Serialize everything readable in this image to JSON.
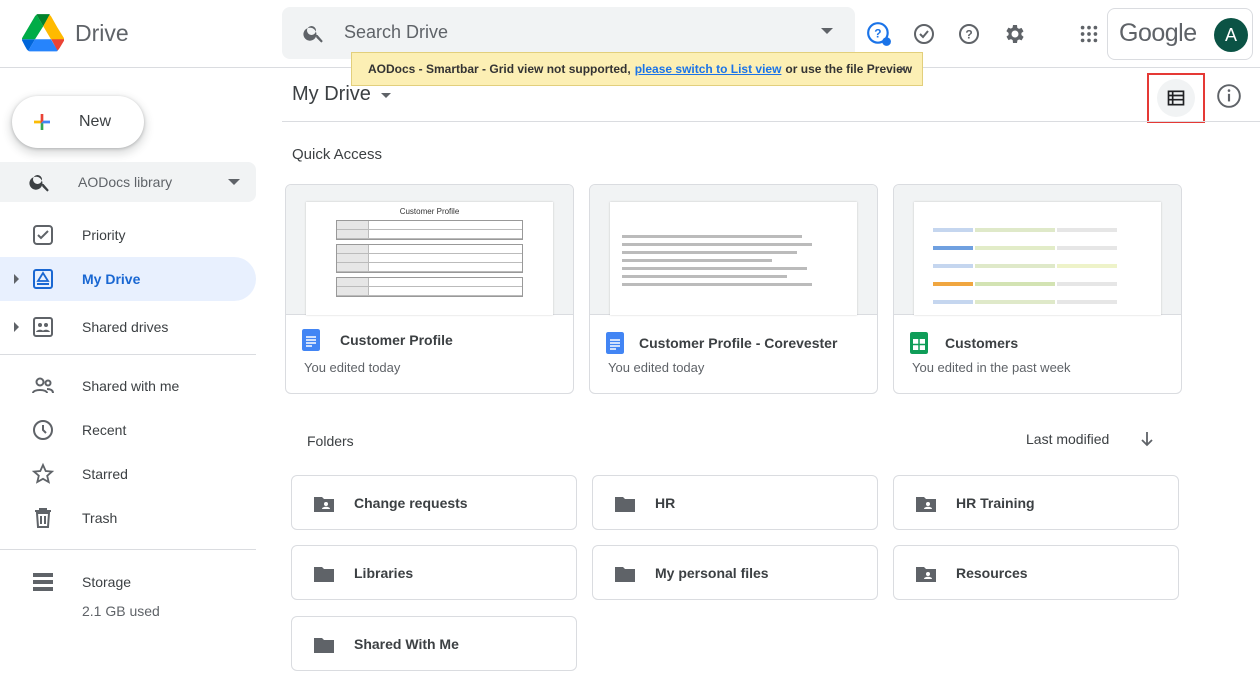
{
  "app": {
    "name": "Drive"
  },
  "search": {
    "placeholder": "Search Drive"
  },
  "account": {
    "brand": "Google",
    "avatar_letter": "A",
    "avatar_color": "#0b5345"
  },
  "smartbar": {
    "prefix": "AODocs - Smartbar - Grid view not supported,",
    "link": "please switch to List view",
    "suffix": "or use the file Preview",
    "close": "×"
  },
  "sidebar": {
    "new_label": "New",
    "library_select": "AODocs library",
    "items": [
      {
        "label": "Priority",
        "icon": "priority-icon"
      },
      {
        "label": "My Drive",
        "icon": "my-drive-icon",
        "active": true
      },
      {
        "label": "Shared drives",
        "icon": "shared-drives-icon"
      },
      {
        "label": "Shared with me",
        "icon": "shared-with-me-icon"
      },
      {
        "label": "Recent",
        "icon": "recent-icon"
      },
      {
        "label": "Starred",
        "icon": "star-icon"
      },
      {
        "label": "Trash",
        "icon": "trash-icon"
      }
    ],
    "storage": {
      "label": "Storage",
      "used": "2.1 GB used"
    }
  },
  "main": {
    "title": "My Drive",
    "quick_access_label": "Quick Access",
    "quick_access": [
      {
        "name": "Customer Profile",
        "sub": "You edited today",
        "type": "doc",
        "preview_title": "Customer Profile"
      },
      {
        "name": "Customer Profile - Corevester",
        "sub": "You edited today",
        "type": "doc"
      },
      {
        "name": "Customers",
        "sub": "You edited in the past week",
        "type": "sheet"
      }
    ],
    "folders_label": "Folders",
    "sort_label": "Last modified",
    "folders": [
      {
        "name": "Change requests",
        "shared": true
      },
      {
        "name": "HR",
        "shared": false
      },
      {
        "name": "HR Training",
        "shared": true
      },
      {
        "name": "Libraries",
        "shared": false
      },
      {
        "name": "My personal files",
        "shared": false
      },
      {
        "name": "Resources",
        "shared": true
      },
      {
        "name": "Shared With Me",
        "shared": false
      }
    ]
  },
  "colors": {
    "accent": "#1967d2",
    "active_bg": "#e8f0fe",
    "doc_blue": "#4285f4",
    "sheet_green": "#0f9d58",
    "highlight": "#e53935"
  }
}
